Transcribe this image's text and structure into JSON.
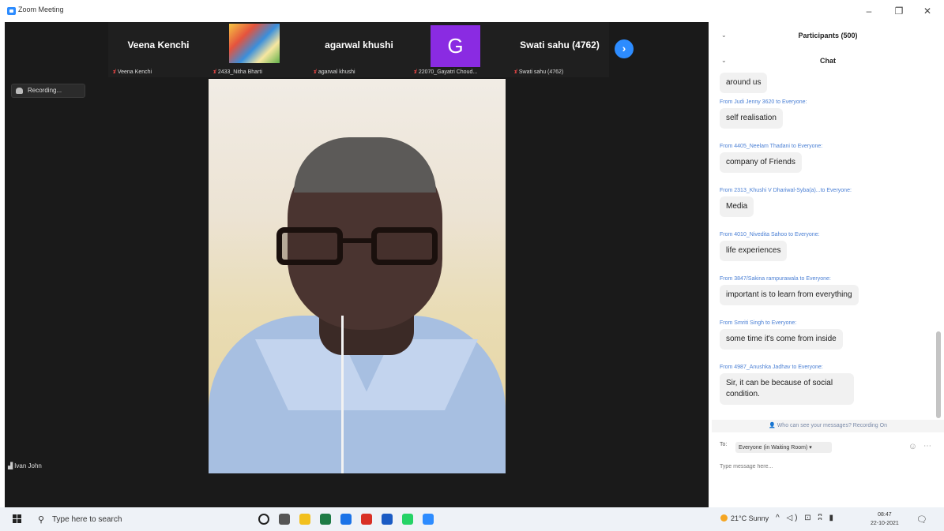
{
  "window": {
    "title": "Zoom Meeting",
    "minimize": "–",
    "maximize": "❐",
    "close": "✕"
  },
  "strip": {
    "tiles": [
      {
        "display": "Veena Kenchi",
        "label": "Veena Kenchi"
      },
      {
        "display": "",
        "label": "2433_Nitha Bharti"
      },
      {
        "display": "agarwal khushi",
        "label": "agarwal khushi"
      },
      {
        "display": "G",
        "label": "22070_Gayatri Choud..."
      },
      {
        "display": "Swati sahu (4762)",
        "label": "Swati sahu (4762)"
      }
    ],
    "next_icon": "chevron-right-icon"
  },
  "recording": {
    "label": "Recording..."
  },
  "active_speaker": {
    "name": "Ivan John"
  },
  "panel": {
    "participants_header": "Participants (500)",
    "chat_header": "Chat",
    "messages": [
      {
        "from": "",
        "text": "around us"
      },
      {
        "from": "From Judi Jenny 3620 to Everyone:",
        "text": "self realisation"
      },
      {
        "from": "From 4405_Neelam Thadani to Everyone:",
        "text": "company of Friends"
      },
      {
        "from": "From 2313_Khushi V Dhariwal-Syba(a)...to Everyone:",
        "text": "Media"
      },
      {
        "from": "From 4010_Nivedita Sahoo to Everyone:",
        "text": "life experiences"
      },
      {
        "from": "From 3847/Sakina rampurawala to Everyone:",
        "text": "important is to learn from everything"
      },
      {
        "from": "From Smriti Singh to Everyone:",
        "text": "some time it's come from inside"
      },
      {
        "from": "From 4987_Anushka Jadhav to Everyone:",
        "text": "Sir, it can be because of social condition."
      }
    ],
    "who_can_see": "Who can see your messages? Recording On",
    "to_label": "To:",
    "to_value": "Everyone (in Waiting Room) ▾",
    "input_placeholder": "Type message here..."
  },
  "taskbar": {
    "search_placeholder": "Type here to search",
    "weather": "21°C Sunny",
    "tray": "^ ◁) ⊡ ʭ ▮",
    "time": "08:47",
    "date": "22-10-2021",
    "app_colors": [
      "#222222",
      "#555555",
      "#f2c01e",
      "#1e7b45",
      "#1a73e8",
      "#d93025",
      "#1a5bc4",
      "#25d366",
      "#2d8cff"
    ]
  }
}
